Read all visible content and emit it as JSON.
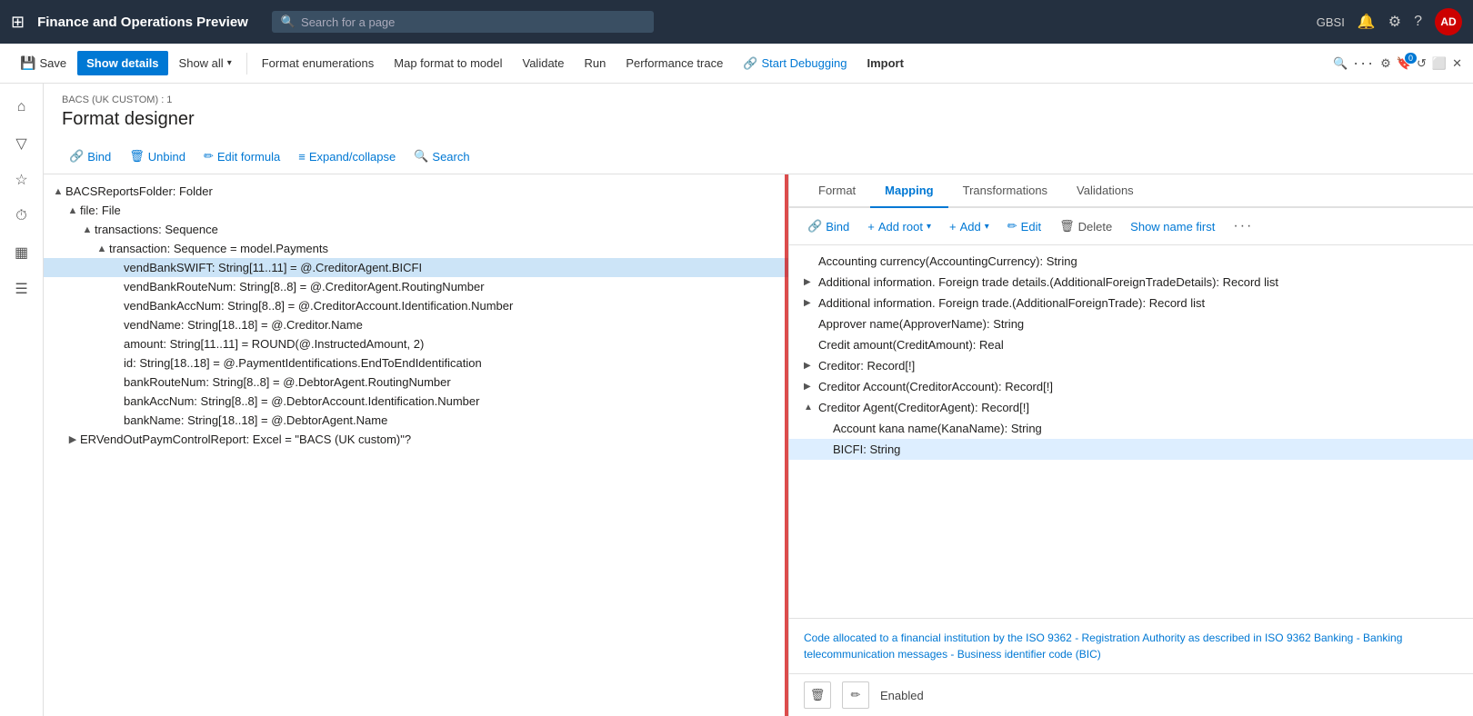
{
  "topbar": {
    "app_title": "Finance and Operations Preview",
    "search_placeholder": "Search for a page",
    "user_initials": "AD",
    "user_region": "GBSI"
  },
  "toolbar": {
    "save_label": "Save",
    "show_details_label": "Show details",
    "show_all_label": "Show all",
    "format_enumerations_label": "Format enumerations",
    "map_format_to_model_label": "Map format to model",
    "validate_label": "Validate",
    "run_label": "Run",
    "performance_trace_label": "Performance trace",
    "start_debugging_label": "Start Debugging",
    "import_label": "Import"
  },
  "page_header": {
    "breadcrumb": "BACS (UK CUSTOM) : 1",
    "title": "Format designer"
  },
  "sub_toolbar": {
    "bind_label": "Bind",
    "unbind_label": "Unbind",
    "edit_formula_label": "Edit formula",
    "expand_collapse_label": "Expand/collapse",
    "search_label": "Search"
  },
  "tree": {
    "items": [
      {
        "id": "bacs-folder",
        "label": "BACSReportsFolder: Folder",
        "indent": 0,
        "arrow": "▲",
        "selected": false
      },
      {
        "id": "file",
        "label": "file: File",
        "indent": 1,
        "arrow": "▲",
        "selected": false
      },
      {
        "id": "transactions",
        "label": "transactions: Sequence",
        "indent": 2,
        "arrow": "▲",
        "selected": false
      },
      {
        "id": "transaction",
        "label": "transaction: Sequence = model.Payments",
        "indent": 3,
        "arrow": "▲",
        "selected": false
      },
      {
        "id": "vendBankSWIFT",
        "label": "vendBankSWIFT: String[11..11] = @.CreditorAgent.BICFI",
        "indent": 4,
        "arrow": "",
        "selected": true
      },
      {
        "id": "vendBankRouteNum",
        "label": "vendBankRouteNum: String[8..8] = @.CreditorAgent.RoutingNumber",
        "indent": 4,
        "arrow": "",
        "selected": false
      },
      {
        "id": "vendBankAccNum",
        "label": "vendBankAccNum: String[8..8] = @.CreditorAccount.Identification.Number",
        "indent": 4,
        "arrow": "",
        "selected": false
      },
      {
        "id": "vendName",
        "label": "vendName: String[18..18] = @.Creditor.Name",
        "indent": 4,
        "arrow": "",
        "selected": false
      },
      {
        "id": "amount",
        "label": "amount: String[11..11] = ROUND(@.InstructedAmount, 2)",
        "indent": 4,
        "arrow": "",
        "selected": false
      },
      {
        "id": "id",
        "label": "id: String[18..18] = @.PaymentIdentifications.EndToEndIdentification",
        "indent": 4,
        "arrow": "",
        "selected": false
      },
      {
        "id": "bankRouteNum",
        "label": "bankRouteNum: String[8..8] = @.DebtorAgent.RoutingNumber",
        "indent": 4,
        "arrow": "",
        "selected": false
      },
      {
        "id": "bankAccNum",
        "label": "bankAccNum: String[8..8] = @.DebtorAccount.Identification.Number",
        "indent": 4,
        "arrow": "",
        "selected": false
      },
      {
        "id": "bankName",
        "label": "bankName: String[18..18] = @.DebtorAgent.Name",
        "indent": 4,
        "arrow": "",
        "selected": false
      },
      {
        "id": "ervendout",
        "label": "ERVendOutPaymControlReport: Excel = \"BACS (UK custom)\"?",
        "indent": 1,
        "arrow": "▶",
        "selected": false
      }
    ]
  },
  "right_tabs": [
    {
      "id": "format",
      "label": "Format",
      "active": false
    },
    {
      "id": "mapping",
      "label": "Mapping",
      "active": true
    },
    {
      "id": "transformations",
      "label": "Transformations",
      "active": false
    },
    {
      "id": "validations",
      "label": "Validations",
      "active": false
    }
  ],
  "right_toolbar": {
    "bind_label": "Bind",
    "add_root_label": "Add root",
    "add_label": "Add",
    "edit_label": "Edit",
    "delete_label": "Delete",
    "show_name_first_label": "Show name first"
  },
  "model_items": [
    {
      "id": "accounting-currency",
      "label": "Accounting currency(AccountingCurrency): String",
      "indent": 0,
      "arrow": "",
      "selected": false
    },
    {
      "id": "add-foreign-trade-details",
      "label": "Additional information. Foreign trade details.(AdditionalForeignTradeDetails): Record list",
      "indent": 0,
      "arrow": "▶",
      "selected": false
    },
    {
      "id": "add-foreign-trade",
      "label": "Additional information. Foreign trade.(AdditionalForeignTrade): Record list",
      "indent": 0,
      "arrow": "▶",
      "selected": false
    },
    {
      "id": "approver-name",
      "label": "Approver name(ApproverName): String",
      "indent": 0,
      "arrow": "",
      "selected": false
    },
    {
      "id": "credit-amount",
      "label": "Credit amount(CreditAmount): Real",
      "indent": 0,
      "arrow": "",
      "selected": false
    },
    {
      "id": "creditor",
      "label": "Creditor: Record[!]",
      "indent": 0,
      "arrow": "▶",
      "selected": false
    },
    {
      "id": "creditor-account",
      "label": "Creditor Account(CreditorAccount): Record[!]",
      "indent": 0,
      "arrow": "▶",
      "selected": false
    },
    {
      "id": "creditor-agent",
      "label": "Creditor Agent(CreditorAgent): Record[!]",
      "indent": 0,
      "arrow": "▲",
      "selected": false
    },
    {
      "id": "account-kana",
      "label": "Account kana name(KanaName): String",
      "indent": 1,
      "arrow": "",
      "selected": false
    },
    {
      "id": "bicfi",
      "label": "BICFI: String",
      "indent": 1,
      "arrow": "",
      "selected": true
    }
  ],
  "description": {
    "text": "Code allocated to a financial institution by the ISO 9362 - Registration Authority as described in ISO 9362 Banking - Banking telecommunication messages - Business identifier code (BIC)"
  },
  "status_bar": {
    "enabled_label": "Enabled"
  }
}
